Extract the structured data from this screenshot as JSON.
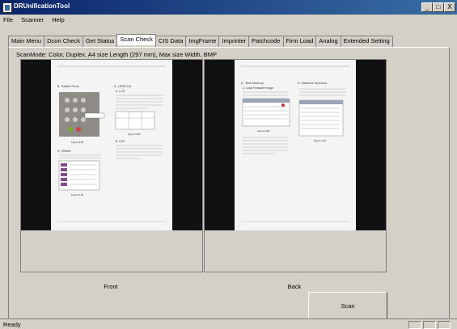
{
  "window": {
    "title": "DRUnificationTool",
    "minimize_label": "_",
    "close_label": "X"
  },
  "menu": {
    "items": [
      {
        "label": "File"
      },
      {
        "label": "Scanner"
      },
      {
        "label": "Help"
      }
    ]
  },
  "tabs": [
    {
      "label": "Main Menu"
    },
    {
      "label": "Dcon Check"
    },
    {
      "label": "Get Status"
    },
    {
      "label": "Scan Check",
      "active": true
    },
    {
      "label": "CIS Data"
    },
    {
      "label": "ImgFrame"
    },
    {
      "label": "Imprinter"
    },
    {
      "label": "Patchcode"
    },
    {
      "label": "Firm Load"
    },
    {
      "label": "Analog"
    },
    {
      "label": "Extended Setting"
    }
  ],
  "scan_mode": "ScanMode: Color, Duplex, A4 size Length (297 mm), Max size Width, BMP",
  "front": {
    "caption": "Front",
    "page": {
      "left_heading": "8. Switch Ports",
      "left_figure": "Figure 8-83",
      "left_section": "9. Others",
      "left_figure2": "Figure 9-84",
      "right_heading": "9. LED/LCD",
      "right_sub1": "A. LCD",
      "right_figure": "Figure 9-85",
      "right_sub2": "B. LED"
    }
  },
  "back": {
    "caption": "Back",
    "page": {
      "left_heading": "D. Test Memory",
      "left_sub": "a. Load Firmware Image",
      "left_figure": "Figure 9-86",
      "right_heading": "E. Network Services",
      "right_figure": "Figure 9-87"
    }
  },
  "scan_button": "Scan",
  "status": "Ready"
}
